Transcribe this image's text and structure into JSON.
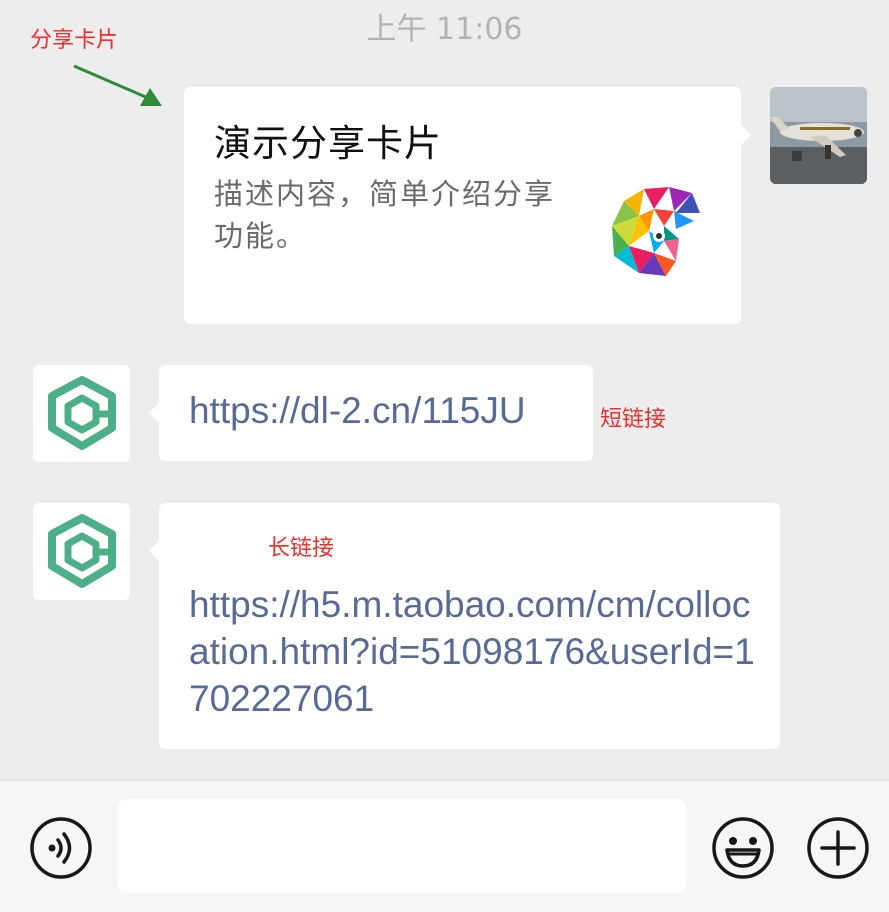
{
  "chat": {
    "timestamp": "上午 11:06",
    "annotations": {
      "share_card": "分享卡片",
      "short_link": "短链接",
      "long_link": "长链接"
    },
    "share_card": {
      "title": "演示分享卡片",
      "description": "描述内容，简单介绍分享功能。",
      "thumbnail_icon": "chameleon-logo-icon"
    },
    "messages": [
      {
        "sender": "bot",
        "avatar_icon": "hexagon-logo-icon",
        "text": "https://dl-2.cn/115JU"
      },
      {
        "sender": "bot",
        "avatar_icon": "hexagon-logo-icon",
        "text": "https://h5.m.taobao.com/cm/collocation.html?id=51098176&userId=1702227061"
      }
    ]
  },
  "input_bar": {
    "voice_icon": "voice-icon",
    "input_value": "",
    "emoji_icon": "emoji-icon",
    "plus_icon": "plus-icon"
  },
  "colors": {
    "background": "#ededed",
    "bubble": "#ffffff",
    "link": "#576b95",
    "annotation": "#e8312f",
    "arrow": "#2e8b3a",
    "logo_green": "#4caf88"
  }
}
